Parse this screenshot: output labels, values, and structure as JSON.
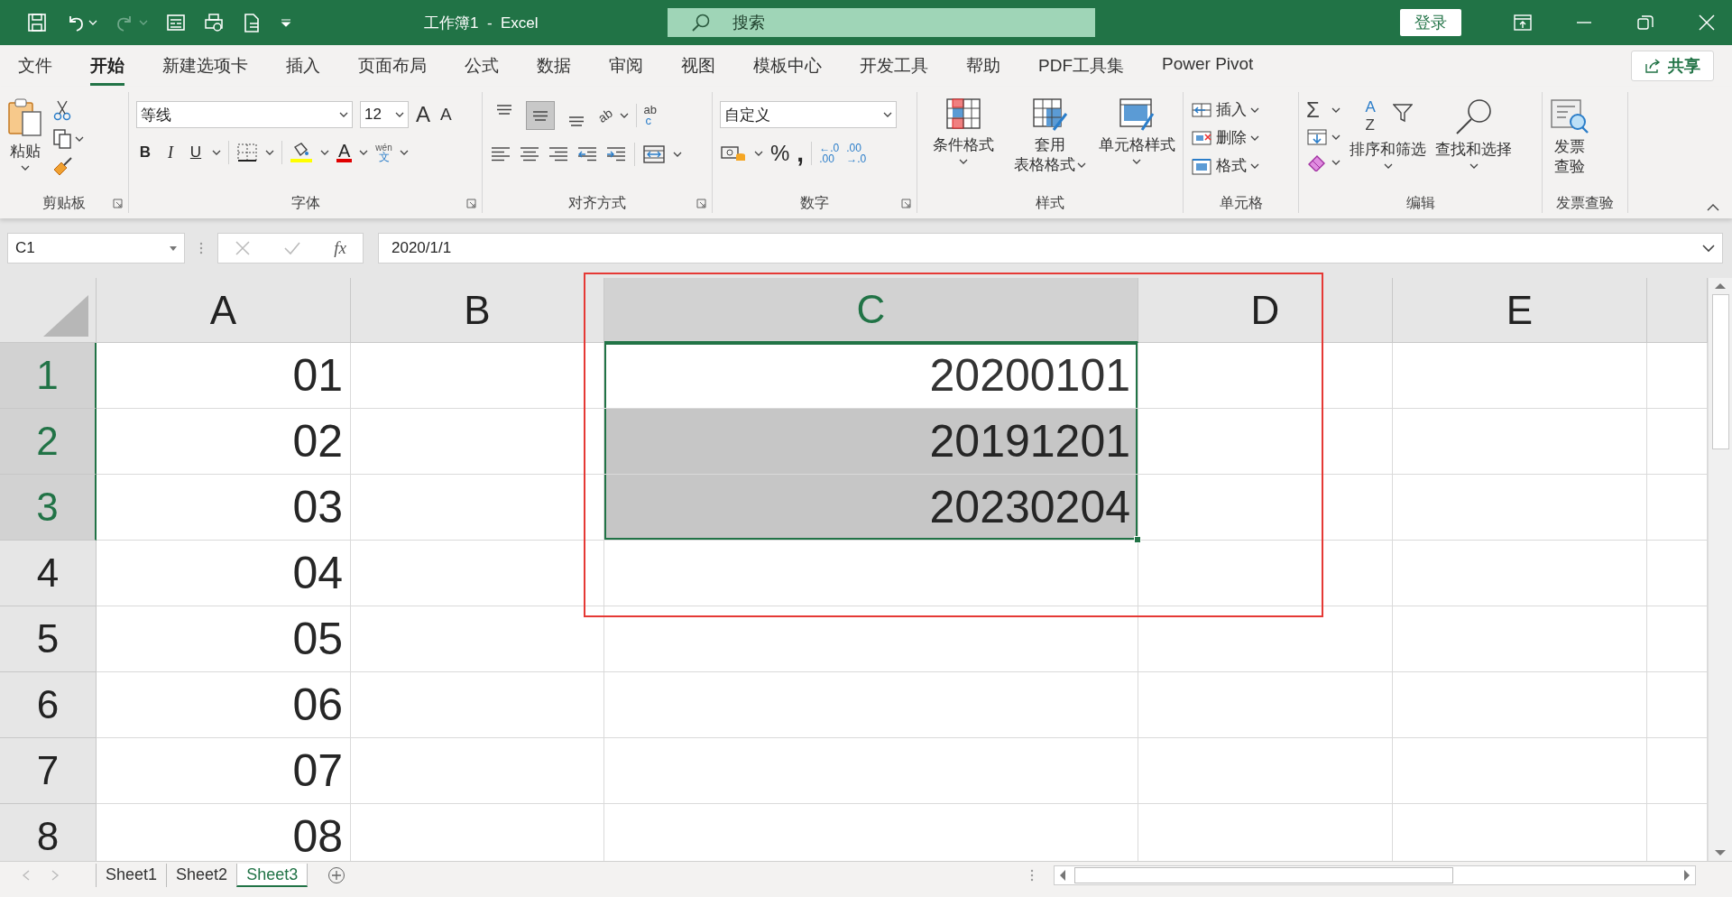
{
  "title_bar": {
    "quick_access": [
      {
        "kind": "save",
        "disabled": false
      },
      {
        "kind": "undo",
        "disabled": false
      },
      {
        "kind": "redo",
        "disabled": true
      },
      {
        "kind": "form",
        "disabled": false
      },
      {
        "kind": "print_preview",
        "disabled": false
      },
      {
        "kind": "document",
        "disabled": false
      },
      {
        "kind": "customize",
        "disabled": false
      }
    ],
    "title": "工作簿1  -  Excel",
    "search": {
      "placeholder": "搜索"
    },
    "sign_in": "登录"
  },
  "ribbon_tabs": [
    {
      "label": "文件",
      "selected": false
    },
    {
      "label": "开始",
      "selected": true
    },
    {
      "label": "新建选项卡",
      "selected": false
    },
    {
      "label": "插入",
      "selected": false
    },
    {
      "label": "页面布局",
      "selected": false
    },
    {
      "label": "公式",
      "selected": false
    },
    {
      "label": "数据",
      "selected": false
    },
    {
      "label": "审阅",
      "selected": false
    },
    {
      "label": "视图",
      "selected": false
    },
    {
      "label": "模板中心",
      "selected": false
    },
    {
      "label": "开发工具",
      "selected": false
    },
    {
      "label": "帮助",
      "selected": false
    },
    {
      "label": "PDF工具集",
      "selected": false
    },
    {
      "label": "Power Pivot",
      "selected": false
    }
  ],
  "share": "共享",
  "ribbon_groups": [
    {
      "kind": "clipboard",
      "label": "剪贴板",
      "paste": "粘贴"
    },
    {
      "kind": "font",
      "label": "字体",
      "font_name": "等线",
      "font_size": "12",
      "grow": "A",
      "shrink": "A",
      "bold": "B",
      "italic": "I",
      "underline": "U",
      "font_color": "A",
      "phonetic": [
        "wén",
        "文"
      ]
    },
    {
      "kind": "alignment",
      "label": "对齐方式",
      "vertical_buttons": [
        {
          "kind": "top",
          "selected": false
        },
        {
          "kind": "middle",
          "selected": true
        },
        {
          "kind": "bottom",
          "selected": false
        }
      ],
      "orientation": "ab",
      "wrap": [
        "ab",
        "c"
      ]
    },
    {
      "kind": "number",
      "label": "数字",
      "format": "自定义",
      "percent": "%",
      "comma": ",",
      "decimals": [
        [
          "←.0",
          ".00"
        ],
        [
          ".00",
          "→.0"
        ]
      ]
    },
    {
      "kind": "styles",
      "label": "样式",
      "buttons": [
        [
          "条件格式"
        ],
        [
          "套用",
          "表格格式"
        ],
        [
          "单元格样式"
        ]
      ]
    },
    {
      "kind": "cells",
      "label": "单元格",
      "buttons": [
        "插入",
        "删除",
        "格式"
      ]
    },
    {
      "kind": "editing",
      "label": "编辑",
      "autosum": "Σ",
      "sort_letters": [
        "A",
        "Z"
      ],
      "sort": "排序和筛选",
      "find": "查找和选择"
    },
    {
      "kind": "invoice",
      "label": "发票查验",
      "button": [
        "发票",
        "查验"
      ]
    }
  ],
  "formula_bar": {
    "name_box": "C1",
    "fx": "fx",
    "value": "2020/1/1"
  },
  "sheet": {
    "columns": [
      {
        "label": "A",
        "selected": false
      },
      {
        "label": "B",
        "selected": false
      },
      {
        "label": "C",
        "selected": true
      },
      {
        "label": "D",
        "selected": false
      },
      {
        "label": "E",
        "selected": false
      }
    ],
    "rows": [
      {
        "label": "1",
        "selected": true,
        "cells": [
          {
            "text": "01",
            "selected": false
          },
          {
            "selected": false
          },
          {
            "text": "20200101",
            "selected": true,
            "active": true
          },
          {
            "selected": false
          },
          {
            "selected": false
          }
        ]
      },
      {
        "label": "2",
        "selected": true,
        "cells": [
          {
            "text": "02",
            "selected": false
          },
          {
            "selected": false
          },
          {
            "text": "20191201",
            "selected": true
          },
          {
            "selected": false
          },
          {
            "selected": false
          }
        ]
      },
      {
        "label": "3",
        "selected": true,
        "cells": [
          {
            "text": "03",
            "selected": false
          },
          {
            "selected": false
          },
          {
            "text": "20230204",
            "selected": true
          },
          {
            "selected": false
          },
          {
            "selected": false
          }
        ]
      },
      {
        "label": "4",
        "selected": false,
        "cells": [
          {
            "text": "04",
            "selected": false
          },
          {
            "selected": false
          },
          {
            "selected": false
          },
          {
            "selected": false
          },
          {
            "selected": false
          }
        ]
      },
      {
        "label": "5",
        "selected": false,
        "cells": [
          {
            "text": "05",
            "selected": false
          },
          {
            "selected": false
          },
          {
            "selected": false
          },
          {
            "selected": false
          },
          {
            "selected": false
          }
        ]
      },
      {
        "label": "6",
        "selected": false,
        "cells": [
          {
            "text": "06",
            "selected": false
          },
          {
            "selected": false
          },
          {
            "selected": false
          },
          {
            "selected": false
          },
          {
            "selected": false
          }
        ]
      },
      {
        "label": "7",
        "selected": false,
        "cells": [
          {
            "text": "07",
            "selected": false
          },
          {
            "selected": false
          },
          {
            "selected": false
          },
          {
            "selected": false
          },
          {
            "selected": false
          }
        ]
      },
      {
        "label": "8",
        "selected": false,
        "cells": [
          {
            "text": "08",
            "selected": false
          },
          {
            "selected": false
          },
          {
            "selected": false
          },
          {
            "selected": false
          },
          {
            "selected": false
          }
        ]
      }
    ]
  },
  "sheet_tabs": [
    {
      "label": "Sheet1",
      "selected": false
    },
    {
      "label": "Sheet2",
      "selected": false
    },
    {
      "label": "Sheet3",
      "selected": true
    }
  ]
}
